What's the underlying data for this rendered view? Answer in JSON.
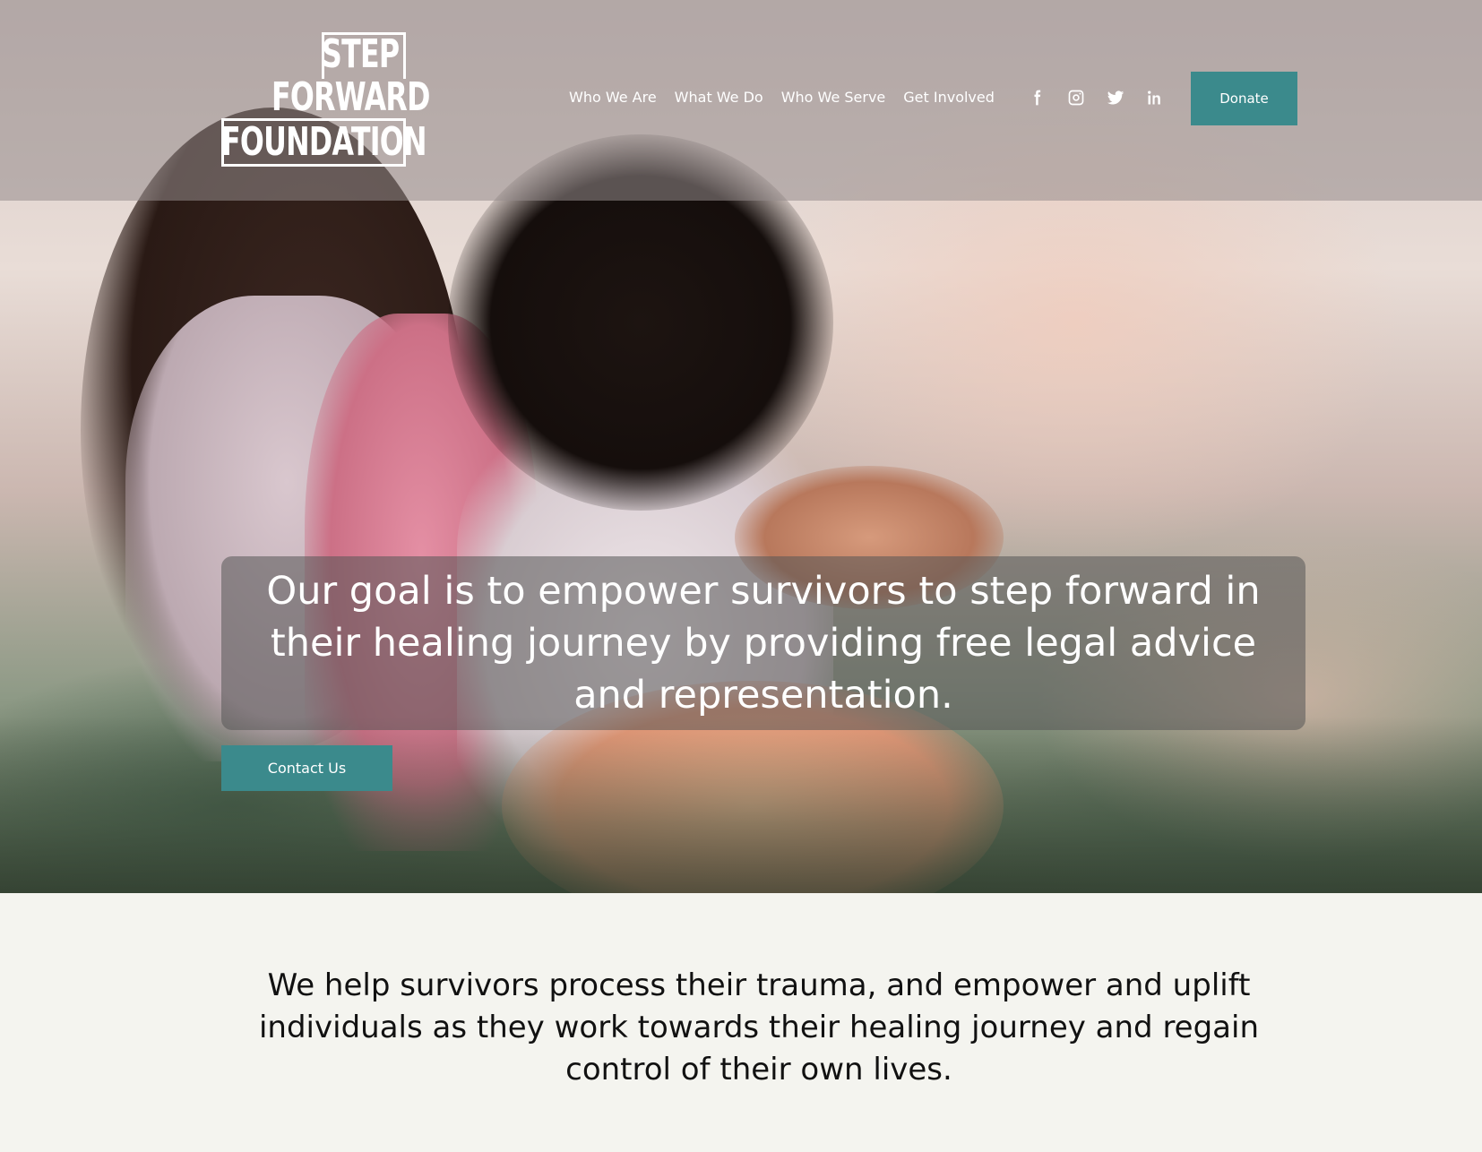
{
  "brand": {
    "logo_line1": "STEP",
    "logo_line2": "FORWARD",
    "logo_line3": "FOUNDATION"
  },
  "nav": {
    "items": [
      {
        "label": "Who We Are"
      },
      {
        "label": "What We Do"
      },
      {
        "label": "Who We Serve"
      },
      {
        "label": "Get Involved"
      }
    ]
  },
  "social": {
    "icons": [
      "facebook-icon",
      "instagram-icon",
      "twitter-icon",
      "linkedin-icon"
    ]
  },
  "header": {
    "donate_label": "Donate"
  },
  "hero": {
    "headline": "Our goal is to empower survivors to step forward in their healing journey by providing free legal advice and representation.",
    "contact_label": "Contact Us"
  },
  "mission": {
    "text": "We help survivors process their trauma, and empower and uplift individuals as they work towards their healing journey and regain control of their own lives."
  },
  "colors": {
    "accent": "#3b8a8c",
    "page_bg": "#f4f4ef",
    "text": "#111111"
  }
}
